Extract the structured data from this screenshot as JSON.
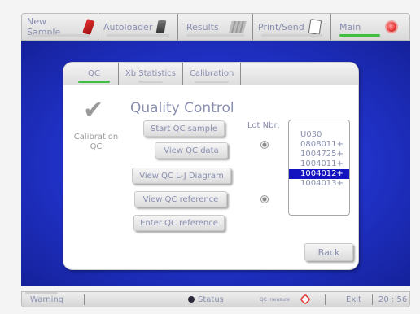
{
  "topnav": {
    "items": [
      {
        "label": "New Sample",
        "icon": "sample-tube-icon",
        "active": false
      },
      {
        "label": "Autoloader",
        "icon": "autoloader-icon",
        "active": false
      },
      {
        "label": "Results",
        "icon": "results-icon",
        "active": false
      },
      {
        "label": "Print/Send",
        "icon": "print-icon",
        "active": false
      },
      {
        "label": "Main",
        "icon": "main-stop-icon",
        "active": true
      }
    ]
  },
  "tabs": [
    {
      "label": "QC",
      "active": true
    },
    {
      "label": "Xb Statistics",
      "active": false
    },
    {
      "label": "Calibration",
      "active": false
    }
  ],
  "panel": {
    "title": "Quality Control",
    "side_label_line1": "Calibration",
    "side_label_line2": "QC",
    "buttons": {
      "start_qc_sample": "Start QC sample",
      "view_qc_data": "View QC data",
      "view_qc_lj": "View QC L-J Diagram",
      "view_qc_reference": "View QC reference",
      "enter_qc_reference": "Enter QC reference"
    },
    "lot_label": "Lot Nbr:",
    "lot_numbers": [
      "U030",
      "0808011+",
      "1004725+",
      "1004011+",
      "1004012+",
      "1004013+"
    ],
    "selected_lot": "1004012+",
    "back_label": "Back"
  },
  "statusbar": {
    "warning": "Warning",
    "status": "Status",
    "qc_measure": "QC measure",
    "exit": "Exit",
    "time": "20 : 56"
  },
  "colors": {
    "accent_active": "#3fbf3f",
    "text": "#8a8fb0",
    "selection": "#1313c0",
    "background_blue": "#2032c8"
  }
}
